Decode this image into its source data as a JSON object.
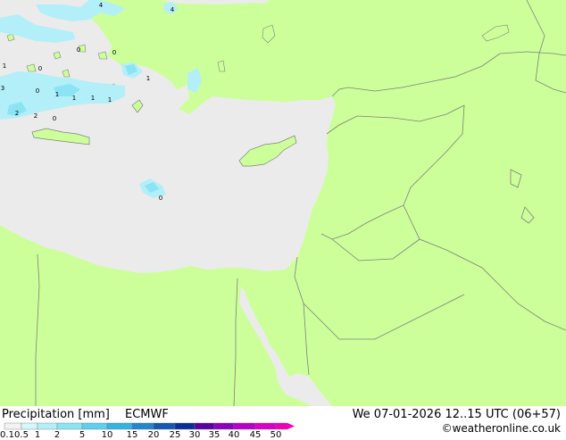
{
  "product": "Precipitation [mm]",
  "model": "ECMWF",
  "valid_time": "We 07-01-2026 12..15 UTC (06+57)",
  "credit": "©weatheronline.co.uk",
  "legend": {
    "ticks": [
      "0.1",
      "0.5",
      "1",
      "2",
      "5",
      "10",
      "15",
      "20",
      "25",
      "30",
      "35",
      "40",
      "45",
      "50"
    ],
    "colors": [
      "#f2f2f2",
      "#d4f7fb",
      "#b3eff8",
      "#8ae4f3",
      "#5ecfec",
      "#35b3e0",
      "#2385cc",
      "#1458b4",
      "#0a2e96",
      "#5b00a0",
      "#8c00bf",
      "#b400c9",
      "#d800c8",
      "#f000b4"
    ]
  },
  "map_colors": {
    "land": "#ccff99",
    "sea": "#ebebeb",
    "border": "#808080",
    "precip_light": "#b3eff8",
    "precip_medium": "#8ae4f3"
  },
  "precip_labels": [
    {
      "text": "4"
    },
    {
      "text": "4"
    },
    {
      "text": "0"
    },
    {
      "text": "0"
    },
    {
      "text": "1"
    },
    {
      "text": "0"
    },
    {
      "text": "1"
    },
    {
      "text": "3"
    },
    {
      "text": "0"
    },
    {
      "text": "1"
    },
    {
      "text": "1"
    },
    {
      "text": "1"
    },
    {
      "text": "1"
    },
    {
      "text": "2"
    },
    {
      "text": "2"
    },
    {
      "text": "0"
    },
    {
      "text": "0"
    }
  ]
}
